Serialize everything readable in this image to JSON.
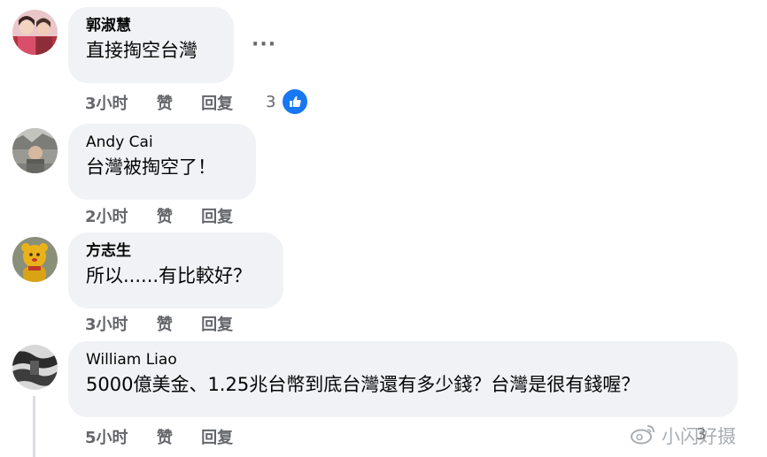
{
  "comments": [
    {
      "author": "郭淑慧",
      "text": "直接掏空台灣",
      "time": "3小时",
      "like_label": "赞",
      "reply_label": "回复",
      "reactions_count": "3",
      "more_label": "···"
    },
    {
      "author": "Andy Cai",
      "text": "台灣被掏空了！",
      "time": "2小时",
      "like_label": "赞",
      "reply_label": "回复"
    },
    {
      "author": "方志生",
      "text": "所以......有比較好？",
      "time": "3小时",
      "like_label": "赞",
      "reply_label": "回复"
    },
    {
      "author": "William Liao",
      "text": "5000億美金、1.25兆台幣到底台灣還有多少錢？台灣是很有錢喔？",
      "time": "5小时",
      "like_label": "赞",
      "reply_label": "回复",
      "reactions_count": "3"
    }
  ],
  "watermark": {
    "text": "小闪好摄",
    "icon": "weibo-icon"
  },
  "colors": {
    "bubble": "#f0f2f5",
    "meta": "#65676b",
    "like": "#1877f2"
  }
}
